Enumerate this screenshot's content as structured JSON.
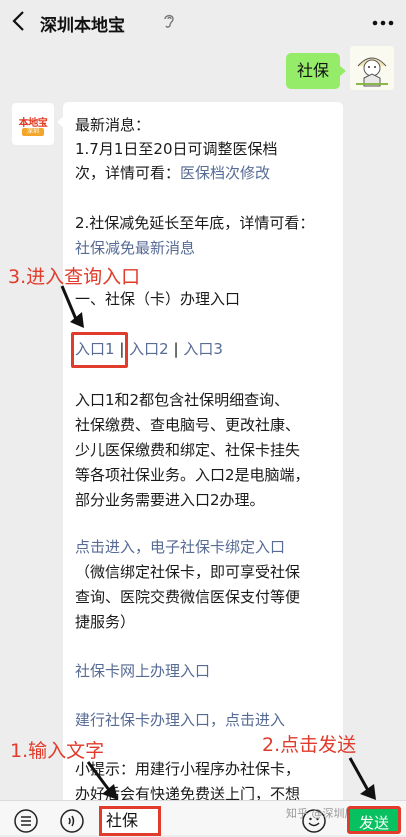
{
  "header": {
    "title": "深圳本地宝"
  },
  "outgoing": {
    "text": "社保"
  },
  "bot_avatar": {
    "logo_top": "本地宝",
    "logo_bottom": "深圳"
  },
  "message": {
    "line1": "最新消息：",
    "line2": "1.7月1日至20日可调整医保档",
    "line3_prefix": "次，详情可看：",
    "line3_link": "医保档次修改",
    "line4": "2.社保减免延长至年底，详情可看：",
    "line5_link": "社保减免最新消息",
    "line6": "一、社保（卡）办理入口",
    "entry1": "入口1",
    "sep1": "|",
    "entry2": "入口2",
    "sep2": "|",
    "entry3": "入口3",
    "para1": "入口1和2都包含社保明细查询、",
    "para2": "社保缴费、查电脑号、更改社康、",
    "para3": "少儿医保缴费和绑定、社保卡挂失",
    "para4": "等各项社保业务。入口2是电脑端，",
    "para5": "部分业务需要进入口2办理。",
    "link_ecard": "点击进入，电子社保卡绑定入口",
    "ecard1": "（微信绑定社保卡，即可享受社保",
    "ecard2": "查询、医院交费微信医保支付等便",
    "ecard3": "捷服务）",
    "link_online": "社保卡网上办理入口",
    "link_ccb": "建行社保卡办理入口，点击进入",
    "tip1": "小提示：用建行小程序办社保卡，",
    "tip2": "办好后会有快递免费送上门，不想"
  },
  "annotations": {
    "step3": "3.进入查询入口",
    "step1": "1.输入文字",
    "step2": "2.点击发送"
  },
  "input": {
    "value": "社保"
  },
  "send": {
    "label": "发送"
  },
  "watermark": {
    "text": "知乎 @深圳房产经纪人"
  },
  "colors": {
    "send_green": "#07c160",
    "bubble_green": "#95ec69",
    "link": "#576b95",
    "annotation_red": "#e03b2b"
  }
}
